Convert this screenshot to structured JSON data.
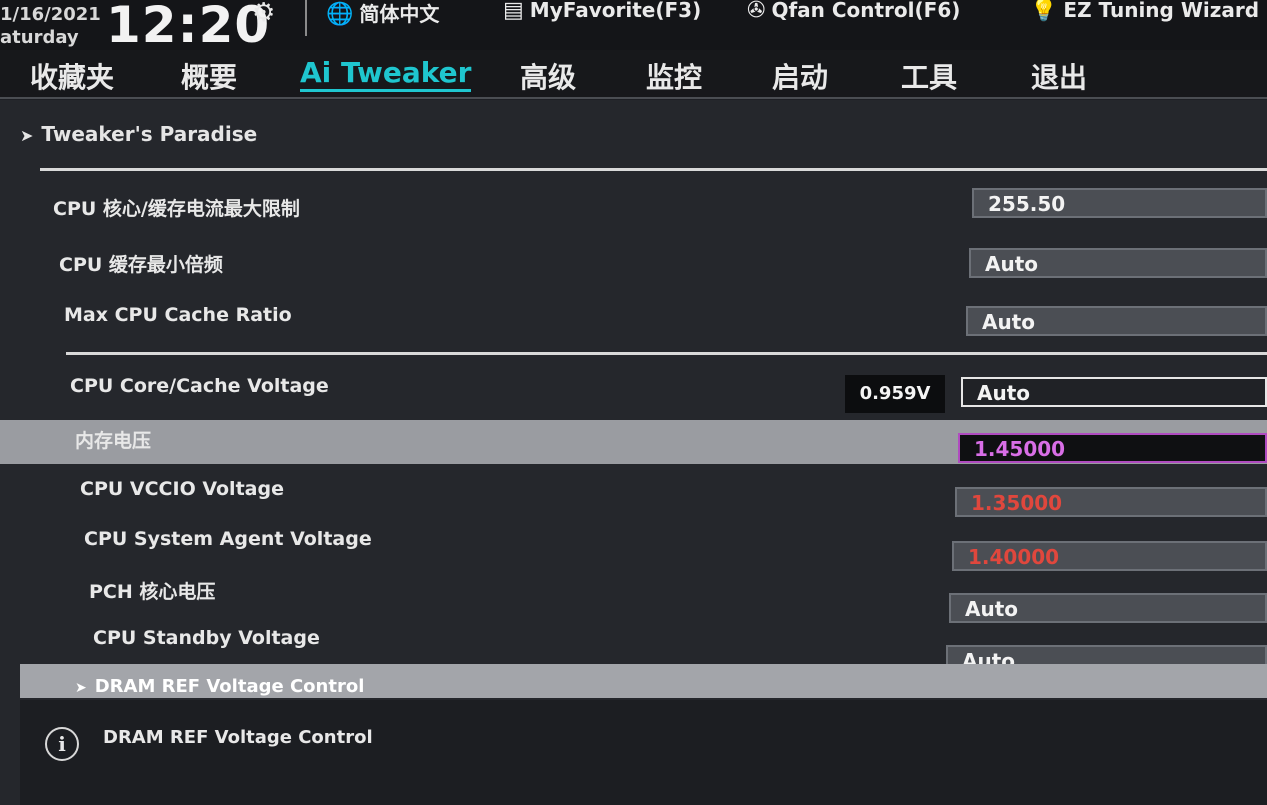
{
  "status_bar": {
    "date": "1/16/2021",
    "weekday": "aturday",
    "time": "12:20",
    "language": "简体中文",
    "my_favorite": "MyFavorite(F3)",
    "qfan_control": "Qfan Control(F6)",
    "ez_tuning": "EZ Tuning Wizard",
    "icons": [
      "gear-icon",
      "globe-icon",
      "myfavorite-icon",
      "fan-icon",
      "bulb-icon"
    ]
  },
  "tabs": [
    {
      "label": "收藏夹",
      "active": false
    },
    {
      "label": "概要",
      "active": false
    },
    {
      "label": "Ai Tweaker",
      "active": true
    },
    {
      "label": "高级",
      "active": false
    },
    {
      "label": "监控",
      "active": false
    },
    {
      "label": "启动",
      "active": false
    },
    {
      "label": "工具",
      "active": false
    },
    {
      "label": "退出",
      "active": false
    }
  ],
  "section": {
    "arrow": "➤",
    "title": "Tweaker's Paradise"
  },
  "settings": [
    {
      "label": "CPU 核心/缓存电流最大限制",
      "value": "255.50"
    },
    {
      "label": "CPU 缓存最小倍频",
      "value": "Auto"
    },
    {
      "label": "Max CPU Cache Ratio",
      "value": "Auto"
    },
    {
      "label": "CPU Core/Cache Voltage",
      "value": "Auto",
      "reading": "0.959V"
    },
    {
      "label": "内存电压",
      "value": "1.45000"
    },
    {
      "label": "CPU VCCIO Voltage",
      "value": "1.35000"
    },
    {
      "label": "CPU System Agent Voltage",
      "value": "1.40000"
    },
    {
      "label": "PCH 核心电压",
      "value": "Auto"
    },
    {
      "label": "CPU Standby Voltage",
      "value": "Auto"
    }
  ],
  "submenu": {
    "arrow": "➤",
    "label": "DRAM REF Voltage Control"
  },
  "help": {
    "icon": "info-icon",
    "text": "DRAM REF Voltage Control"
  },
  "colors": {
    "accent": "#1fc6cf",
    "warning_value": "#e0473d",
    "selected_value": "#d86ee6"
  }
}
